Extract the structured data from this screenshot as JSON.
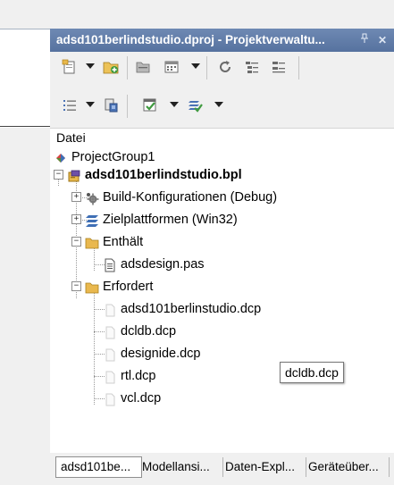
{
  "left_pane": {
    "pin_icon": "chevron-down-icon",
    "close_icon": "close-icon"
  },
  "panel": {
    "title": "adsd101berlindstudio.dproj - Projektverwaltu...",
    "pin_label": "📌",
    "close_label": "✕",
    "column_header": "Datei"
  },
  "tree": {
    "group": "ProjectGroup1",
    "project": "adsd101berlindstudio.bpl",
    "build_config": "Build-Konfigurationen (Debug)",
    "platforms": "Zielplattformen (Win32)",
    "contains": "Enthält",
    "contains_file": "adsdesign.pas",
    "requires": "Erfordert",
    "requires_items": [
      "adsd101berlinstudio.dcp",
      "dcldb.dcp",
      "designide.dcp",
      "rtl.dcp",
      "vcl.dcp"
    ]
  },
  "tooltip": "dcldb.dcp",
  "tabs": [
    "adsd101be...",
    "Modellansi...",
    "Daten-Expl...",
    "Geräteüber..."
  ],
  "colors": {
    "title_bar": "#5b77a4",
    "folder": "#e9b84e",
    "selection_border": "#8f8f8f"
  }
}
